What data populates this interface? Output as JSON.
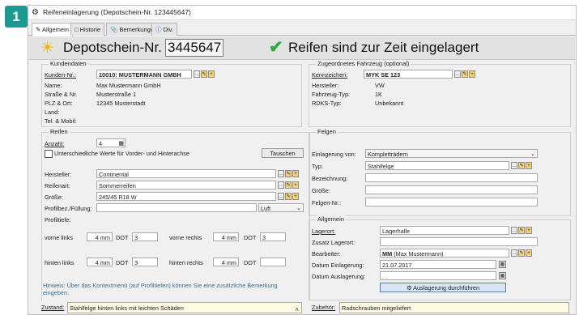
{
  "badge": "1",
  "window": {
    "title": "Reifeneinlagerung (Depotschein-Nr. 123445647)"
  },
  "tabs": [
    "Allgemein",
    "Historie",
    "Bemerkungen",
    "Div."
  ],
  "header": {
    "depot_label": "Depotschein-Nr.",
    "depot_number": "3445647",
    "status": "Reifen sind zur Zeit eingelagert"
  },
  "kundendaten": {
    "title": "Kundendaten",
    "kunden_nr_label": "Kunden-Nr.:",
    "kunden_nr_value": "10010: MUSTERMANN GMBH",
    "name_label": "Name:",
    "name_value": "Max Mustermann GmbH",
    "strasse_label": "Straße & Nr.",
    "strasse_value": "Musterstraße 1",
    "plz_label": "PLZ & Ort:",
    "plz_value": "12345 Musterstadt",
    "land_label": "Land:",
    "tel_label": "Tel. & Mobil:"
  },
  "fahrzeug": {
    "title": "Zugeordnetes Fahrzeug (optional)",
    "kennzeichen_label": "Kennzeichen:",
    "kennzeichen_value": "MYK SE 123",
    "hersteller_label": "Hersteller:",
    "hersteller_value": "VW",
    "typ_label": "Fahrzeug-Typ:",
    "typ_value": "1K",
    "rdks_label": "RDKS-Typ:",
    "rdks_value": "Unbekannt"
  },
  "reifen": {
    "title": "Reifen",
    "anzahl_label": "Anzahl:",
    "anzahl_value": "4",
    "unterschiedlich_label": "Unterschiedliche Werte für Vorder- und Hinterachse",
    "tauschen_label": "Tauschen",
    "hersteller_label": "Hersteller:",
    "hersteller_value": "Continental",
    "reifenart_label": "Reifenart:",
    "reifenart_value": "Sommerreifen",
    "groesse_label": "Größe:",
    "groesse_value": "245/45 R18 W",
    "profilbez_label": "Profilbez./Füllung:",
    "fuellung_value": "Luft",
    "profiltiefe_label": "Profiltiefe:",
    "vorne_links_label": "vorne links",
    "vorne_links_mm": "4 mm",
    "vorne_links_dot": "3",
    "vorne_rechts_label": "vorne rechts",
    "vorne_rechts_mm": "4 mm",
    "vorne_rechts_dot": "3",
    "hinten_links_label": "hinten links",
    "hinten_links_mm": "4 mm",
    "hinten_links_dot": "3",
    "hinten_rechts_label": "hinten rechts",
    "hinten_rechts_mm": "4 mm",
    "hinten_rechts_dot": "",
    "dot_label": "DOT",
    "hinweis": "Hinweis: Über das Kontextmenü (auf Profiltiefen) können Sie eine zusätzliche Bemerkung eingeben."
  },
  "felgen": {
    "title": "Felgen",
    "einlagerung_label": "Einlagerung von:",
    "einlagerung_value": "Kompletträdern",
    "typ_label": "Typ:",
    "typ_value": "Stahlfelge",
    "bezeichnung_label": "Bezeichnung:",
    "groesse_label": "Größe:",
    "felgen_nr_label": "Felgen-Nr.:"
  },
  "allgemein": {
    "title": "Allgemein",
    "lagerort_label": "Lagerort:",
    "lagerort_value": "Lagerhalle",
    "zusatz_label": "Zusatz Lagerort:",
    "bearbeiter_label": "Bearbeiter:",
    "bearbeiter_bold": "MM",
    "bearbeiter_rest": "(Max Mustermann)",
    "datum_ein_label": "Datum Einlagerung:",
    "datum_ein_value": "21.07.2017",
    "datum_aus_label": "Datum Auslagerung:",
    "datum_aus_value": ". .",
    "auslagerung_button": "Auslagerung durchführen"
  },
  "bottom": {
    "zustand_label": "Zustand:",
    "zustand_value": "Stahlfelge hinten links mit leichten Schäden",
    "zubehoer_label": "Zubehör:",
    "zubehoer_value": "Radschrauben mitgeliefert"
  }
}
